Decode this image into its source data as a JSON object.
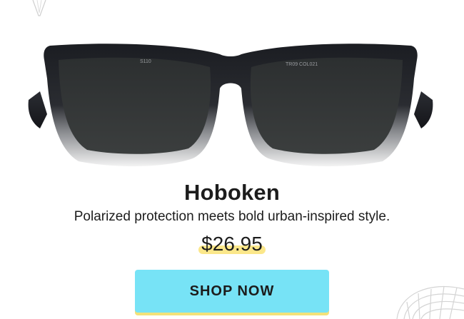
{
  "product": {
    "name": "Hoboken",
    "tagline": "Polarized protection meets bold urban-inspired style.",
    "price": "$26.95",
    "temple_text_left": "S110",
    "temple_text_right": "TR09 COL021"
  },
  "cta": {
    "label": "SHOP NOW"
  },
  "colors": {
    "button": "#77e3f6",
    "price_highlight": "#fbe78a",
    "text": "#1c1c1c"
  },
  "icons": [
    "decorative-leaf-icon",
    "decorative-shell-icon"
  ]
}
